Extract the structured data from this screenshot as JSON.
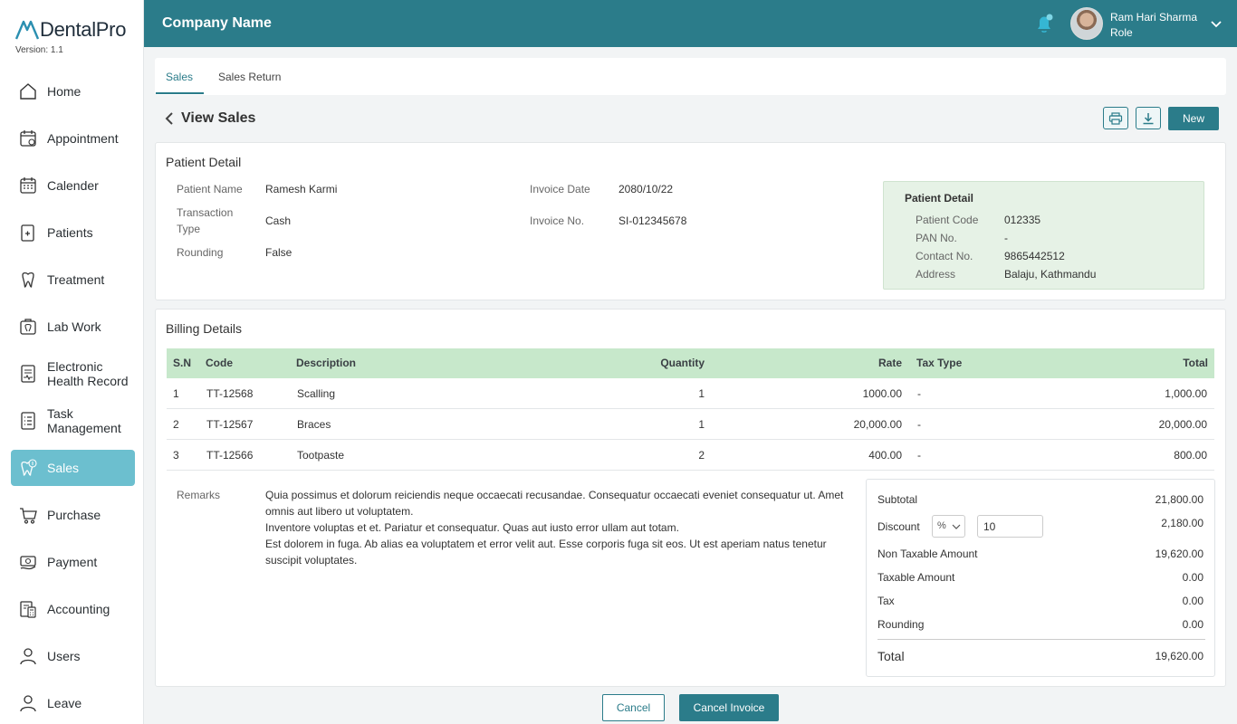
{
  "app": {
    "logo_text": "DentalPro",
    "version": "Version: 1.1"
  },
  "header": {
    "company": "Company Name",
    "user_name": "Ram Hari Sharma",
    "user_role": "Role"
  },
  "sidebar": {
    "items": [
      {
        "label": "Home",
        "icon": "home-icon"
      },
      {
        "label": "Appointment",
        "icon": "calendar-clock-icon"
      },
      {
        "label": "Calender",
        "icon": "calendar-icon"
      },
      {
        "label": "Patients",
        "icon": "patients-icon"
      },
      {
        "label": "Treatment",
        "icon": "treatment-icon"
      },
      {
        "label": "Lab Work",
        "icon": "lab-work-icon"
      },
      {
        "label": "Electronic Health Record",
        "icon": "ehr-icon"
      },
      {
        "label": "Task Management",
        "icon": "task-icon"
      },
      {
        "label": "Sales",
        "icon": "sales-icon",
        "active": true
      },
      {
        "label": "Purchase",
        "icon": "cart-icon"
      },
      {
        "label": "Payment",
        "icon": "payment-icon"
      },
      {
        "label": "Accounting",
        "icon": "accounting-icon"
      },
      {
        "label": "Users",
        "icon": "user-icon"
      },
      {
        "label": "Leave",
        "icon": "leave-icon"
      }
    ]
  },
  "tabs": [
    {
      "label": "Sales",
      "active": true
    },
    {
      "label": "Sales Return"
    }
  ],
  "page": {
    "title": "View Sales",
    "new_label": "New"
  },
  "patient": {
    "section_title": "Patient Detail",
    "name_k": "Patient Name",
    "name_v": "Ramesh Karmi",
    "ttype_k": "Transaction Type",
    "ttype_v": "Cash",
    "round_k": "Rounding",
    "round_v": "False",
    "date_k": "Invoice Date",
    "date_v": "2080/10/22",
    "inv_k": "Invoice No.",
    "inv_v": "SI-012345678",
    "box": {
      "title": "Patient Detail",
      "code_k": "Patient Code",
      "code_v": "012335",
      "pan_k": "PAN No.",
      "pan_v": "-",
      "contact_k": "Contact No.",
      "contact_v": "9865442512",
      "addr_k": "Address",
      "addr_v": "Balaju, Kathmandu"
    }
  },
  "billing": {
    "title": "Billing Details",
    "columns": [
      "S.N",
      "Code",
      "Description",
      "Quantity",
      "Rate",
      "Tax Type",
      "Total"
    ],
    "rows": [
      [
        "1",
        "TT-12568",
        "Scalling",
        "1",
        "1000.00",
        "-",
        "1,000.00"
      ],
      [
        "2",
        "TT-12567",
        "Braces",
        "1",
        "20,000.00",
        "-",
        "20,000.00"
      ],
      [
        "3",
        "TT-12566",
        "Tootpaste",
        "2",
        "400.00",
        "-",
        "800.00"
      ]
    ],
    "remarks_label": "Remarks",
    "remarks": "Quia possimus et dolorum reiciendis neque occaecati recusandae. Consequatur occaecati eveniet consequatur ut. Amet omnis aut libero ut voluptatem.\n  Inventore voluptas et et. Pariatur et consequatur. Quas aut iusto error ullam aut totam.\n  Est dolorem in fuga. Ab alias ea voluptatem et error velit aut. Esse corporis fuga sit eos. Ut est aperiam natus tenetur suscipit voluptates."
  },
  "summary": {
    "subtotal_k": "Subtotal",
    "subtotal_v": "21,800.00",
    "discount_k": "Discount",
    "discount_type": "%",
    "discount_input": "10",
    "discount_v": "2,180.00",
    "nontax_k": "Non Taxable Amount",
    "nontax_v": "19,620.00",
    "taxable_k": "Taxable Amount",
    "taxable_v": "0.00",
    "tax_k": "Tax",
    "tax_v": "0.00",
    "rounding_k": "Rounding",
    "rounding_v": "0.00",
    "total_k": "Total",
    "total_v": "19,620.00"
  },
  "footer": {
    "cancel": "Cancel",
    "cancel_invoice": "Cancel Invoice"
  },
  "colors": {
    "primary": "#2b7c8a",
    "active_nav": "#6cbfcf",
    "table_header": "#c7e8cb",
    "bell": "#35b6d3"
  }
}
